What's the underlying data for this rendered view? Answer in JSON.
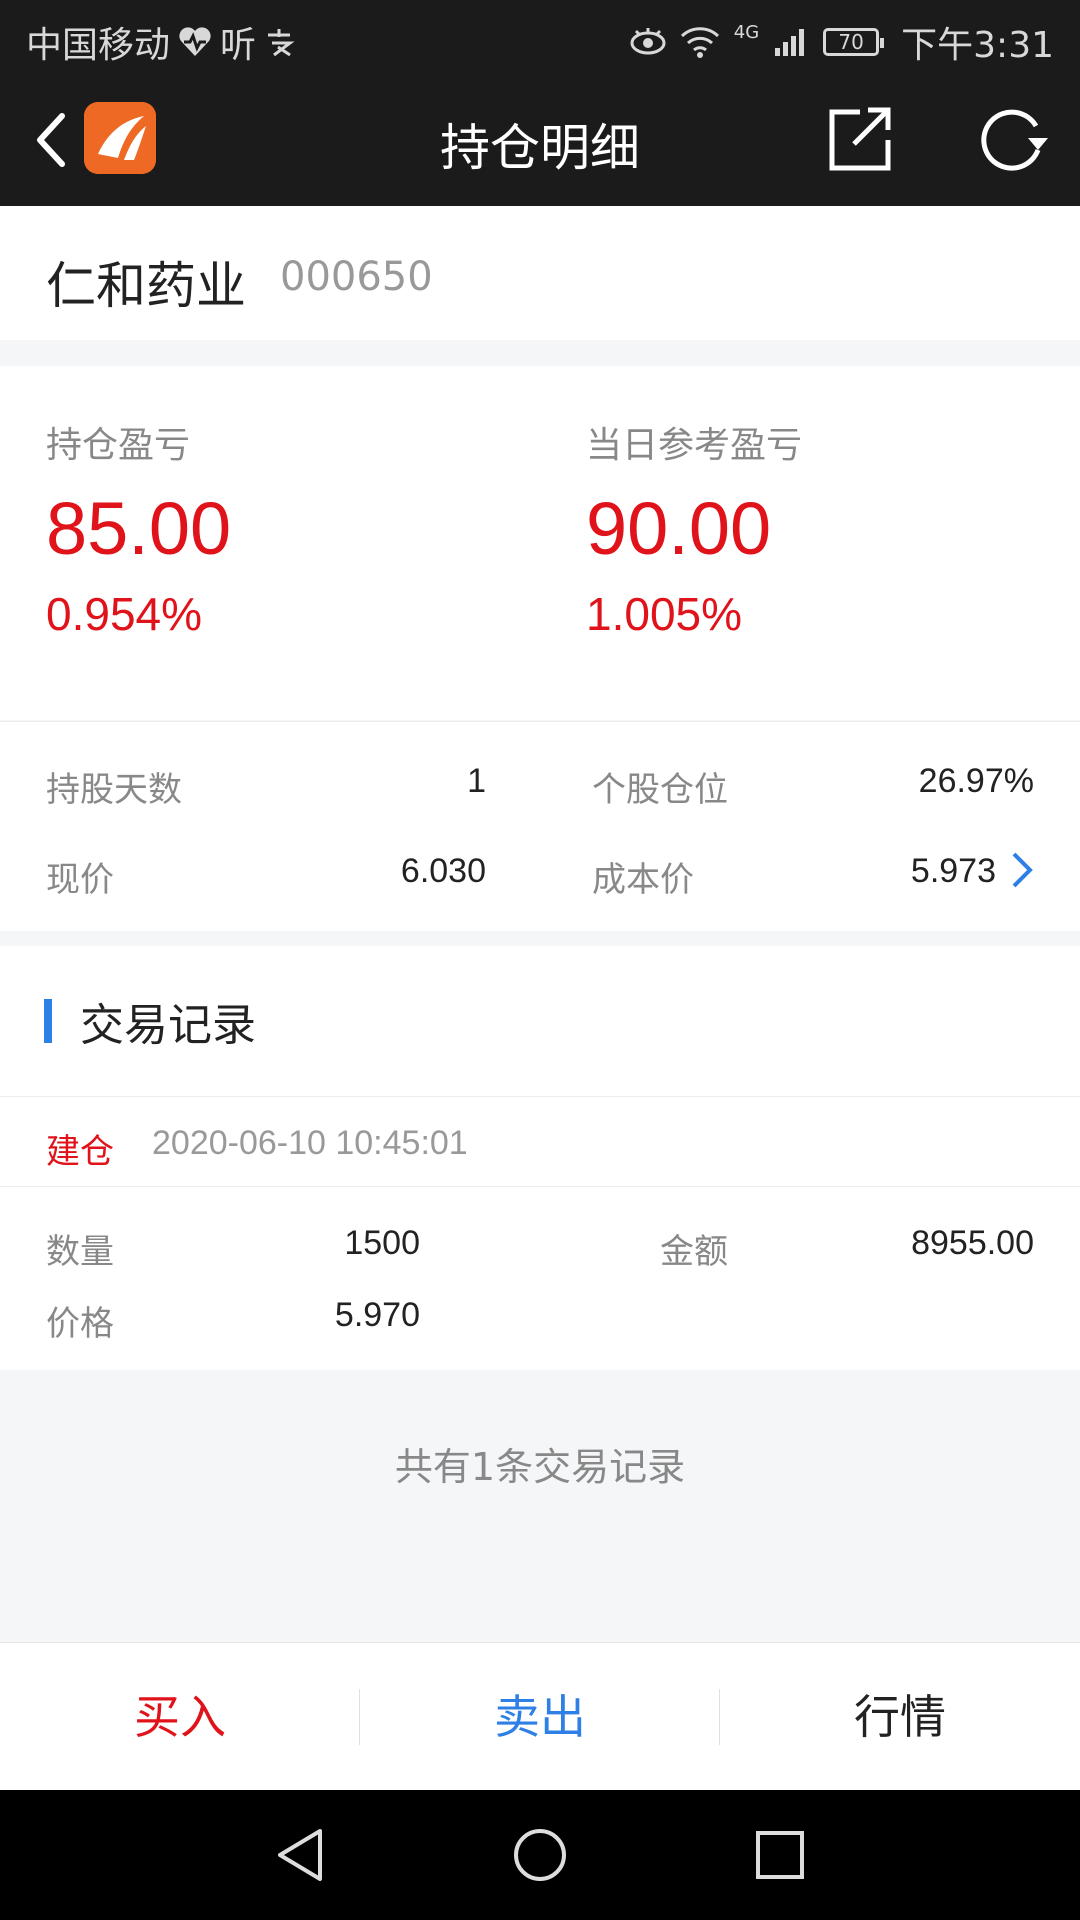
{
  "status_bar": {
    "carrier": "中国移动",
    "app_glyphs": "听",
    "network": "4G",
    "battery": "70",
    "time": "下午3:31"
  },
  "title_bar": {
    "title": "持仓明细"
  },
  "stock": {
    "name": "仁和药业",
    "code": "000650"
  },
  "pnl": {
    "position_label": "持仓盈亏",
    "position_value": "85.00",
    "position_pct": "0.954%",
    "daily_label": "当日参考盈亏",
    "daily_value": "90.00",
    "daily_pct": "1.005%"
  },
  "details": {
    "holding_days_label": "持股天数",
    "holding_days": "1",
    "position_ratio_label": "个股仓位",
    "position_ratio": "26.97%",
    "current_price_label": "现价",
    "current_price": "6.030",
    "cost_price_label": "成本价",
    "cost_price": "5.973"
  },
  "records": {
    "section_title": "交易记录",
    "items": [
      {
        "type": "建仓",
        "time": "2020-06-10 10:45:01",
        "quantity_label": "数量",
        "quantity": "1500",
        "amount_label": "金额",
        "amount": "8955.00",
        "price_label": "价格",
        "price": "5.970"
      }
    ],
    "summary": "共有1条交易记录"
  },
  "actions": {
    "buy": "买入",
    "sell": "卖出",
    "quote": "行情"
  },
  "colors": {
    "up_red": "#e0121a",
    "accent_blue": "#2f80e6",
    "topbar": "#1b1b1b",
    "logo_orange": "#ee6a24"
  }
}
